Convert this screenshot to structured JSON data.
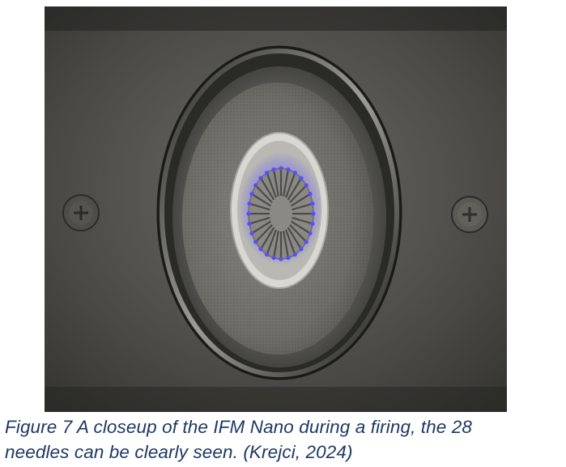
{
  "figure": {
    "caption_line1": "Figure 7 A closeup of the IFM Nano during a firing, the 28",
    "caption_line2": "needles can be clearly seen. (Krejci, 2024)",
    "caption_color": "#1f3864",
    "photo": {
      "subject": "emitter-closeup",
      "emitter_glow_color": "#5a4cff",
      "needle_count": 28
    }
  }
}
